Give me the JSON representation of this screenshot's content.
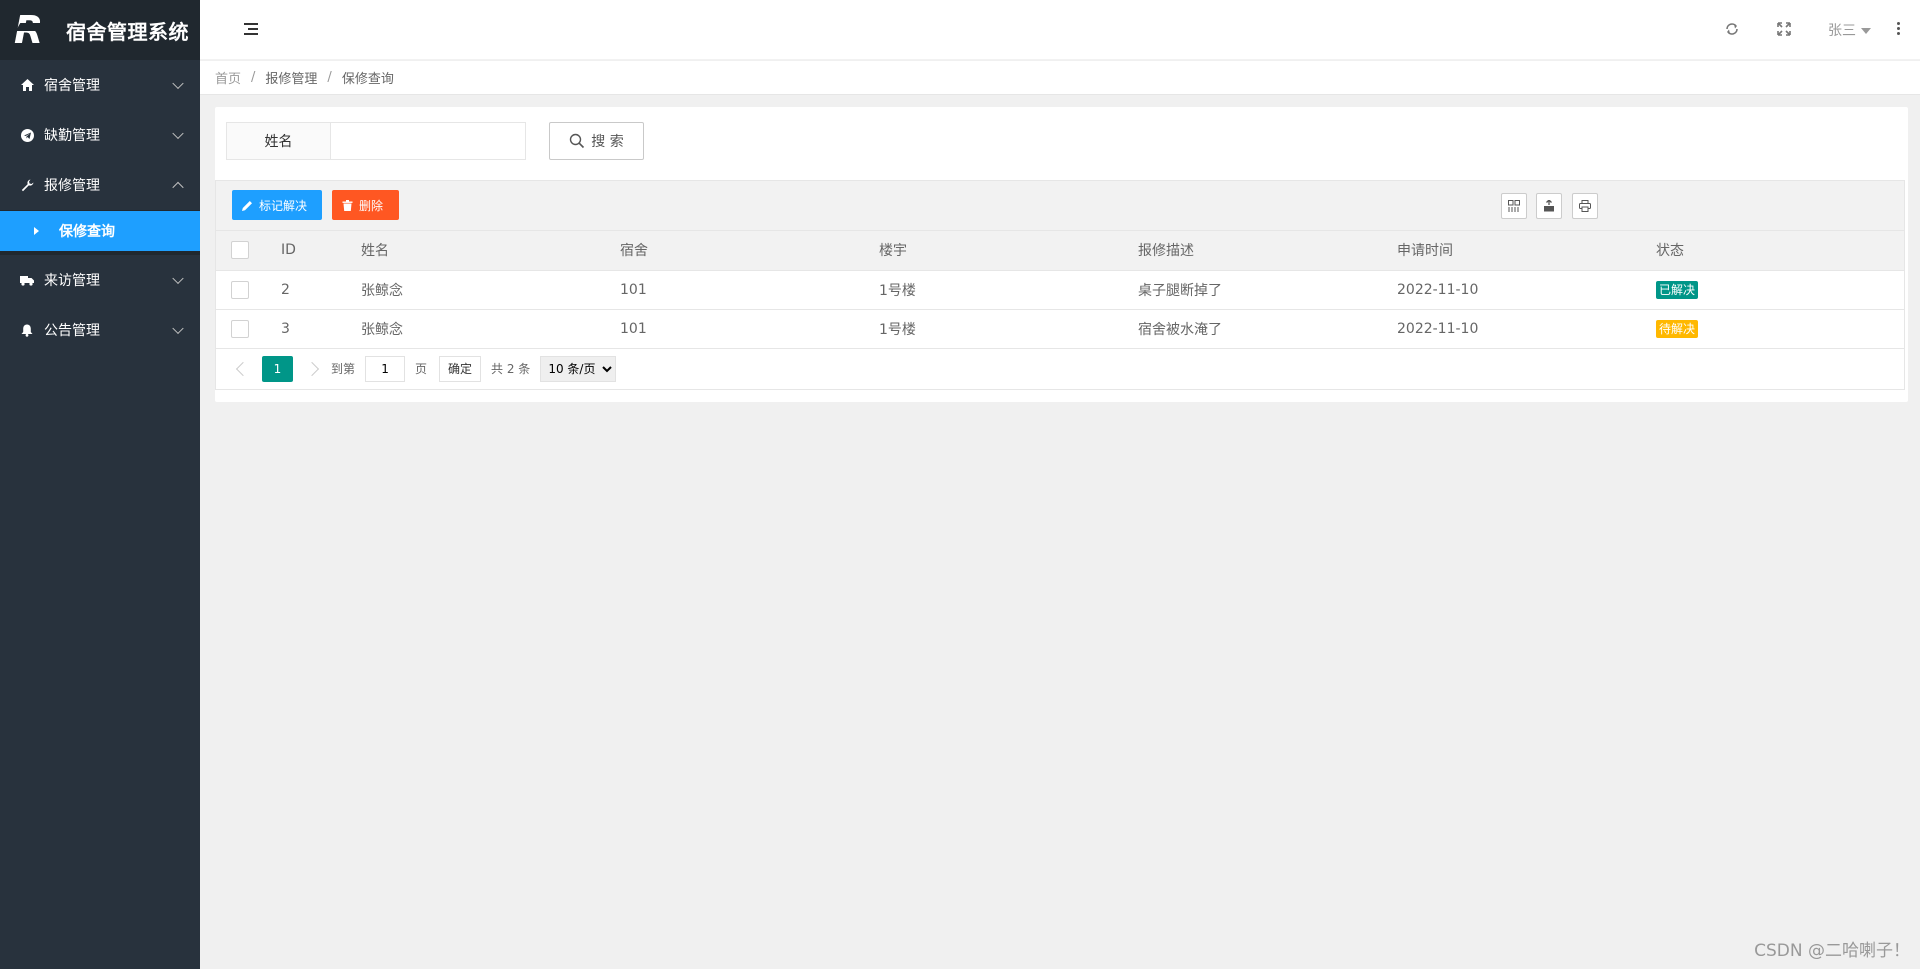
{
  "app": {
    "title": "宿舍管理系统"
  },
  "sidebar": {
    "items": [
      {
        "label": "宿舍管理"
      },
      {
        "label": "缺勤管理"
      },
      {
        "label": "报修管理"
      },
      {
        "label": "来访管理"
      },
      {
        "label": "公告管理"
      }
    ],
    "subitem": {
      "label": "保修查询"
    }
  },
  "header": {
    "user": "张三"
  },
  "breadcrumb": [
    "首页",
    "报修管理",
    "保修查询"
  ],
  "search": {
    "label": "姓名",
    "value": "",
    "placeholder": "",
    "button": "搜 索"
  },
  "toolbar": {
    "mark_resolved": "标记解决",
    "delete": "删除"
  },
  "table": {
    "headers": [
      "ID",
      "姓名",
      "宿舍",
      "楼宇",
      "报修描述",
      "申请时间",
      "状态"
    ],
    "rows": [
      {
        "id": "2",
        "name": "张鲸念",
        "dorm": "101",
        "building": "1号楼",
        "desc": "桌子腿断掉了",
        "time": "2022-11-10",
        "status": "已解决",
        "status_color": "#009688"
      },
      {
        "id": "3",
        "name": "张鲸念",
        "dorm": "101",
        "building": "1号楼",
        "desc": "宿舍被水淹了",
        "time": "2022-11-10",
        "status": "待解决",
        "status_color": "#ffb800"
      }
    ]
  },
  "pager": {
    "current": "1",
    "goto_label": "到第",
    "goto_value": "1",
    "page_label": "页",
    "ok": "确定",
    "total": "共 2 条",
    "per_page": "10 条/页"
  },
  "colors": {
    "accent": "#1e9fff",
    "danger": "#ff5722",
    "success": "#009688",
    "warning": "#ffb800",
    "sidebar": "#28323d"
  },
  "watermark": "CSDN @二哈喇子！"
}
